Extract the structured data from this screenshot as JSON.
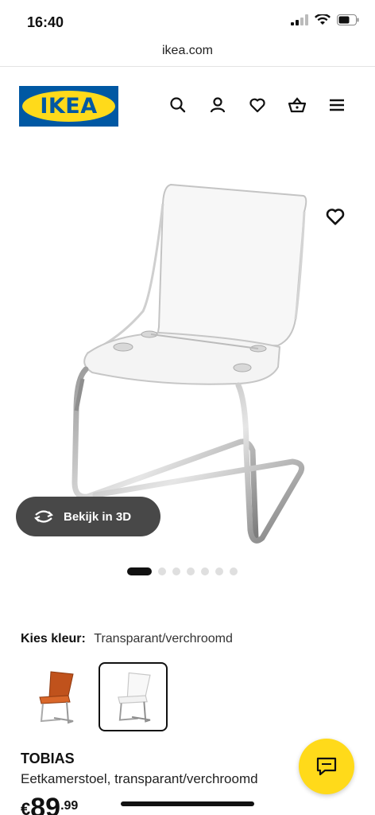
{
  "status_bar": {
    "time": "16:40"
  },
  "browser": {
    "url": "ikea.com"
  },
  "header": {
    "logo_text": "IKEA",
    "icons": [
      "search-icon",
      "user-icon",
      "heart-icon",
      "basket-icon",
      "menu-icon"
    ]
  },
  "gallery": {
    "view_3d_label": "Bekijk in 3D",
    "slide_count": 7,
    "active_slide": 1
  },
  "color_picker": {
    "label": "Kies kleur:",
    "selected_value": "Transparant/verchroomd",
    "swatches": [
      "orange-chair",
      "transparent-chair"
    ],
    "selected_swatch": 2
  },
  "product": {
    "name": "TOBIAS",
    "description": "Eetkamerstoel, transparant/verchroomd",
    "price_currency": "€",
    "price_integer": "89",
    "price_decimal": ".99"
  },
  "colors": {
    "ikea_blue": "#0058a3",
    "ikea_yellow": "#ffda1a",
    "button_dark": "#484848"
  }
}
